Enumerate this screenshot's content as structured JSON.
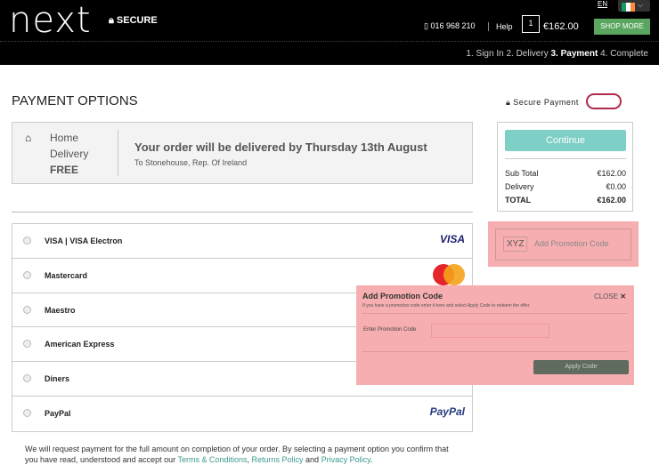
{
  "header": {
    "logo": "next",
    "secure": "SECURE",
    "phone": "016 968 210",
    "help": "Help",
    "bag_count": "1",
    "bag_total": "€162.00",
    "shop_more": "SHOP MORE",
    "language": "EN",
    "steps": [
      "1. Sign In",
      "2. Delivery",
      "3. Payment",
      "4. Complete"
    ],
    "active_step": 2
  },
  "page_title": "PAYMENT OPTIONS",
  "delivery": {
    "line1": "Home",
    "line2": "Delivery",
    "line3": "FREE",
    "message": "Your order will be delivered by Thursday 13th August",
    "address": "To Stonehouse, Rep. Of Ireland"
  },
  "payment_options": [
    {
      "label": "VISA | VISA Electron",
      "logo": "VISA"
    },
    {
      "label": "Mastercard",
      "logo": "MasterCard"
    },
    {
      "label": "Maestro",
      "logo": ""
    },
    {
      "label": "American Express",
      "logo": ""
    },
    {
      "label": "Diners",
      "logo": ""
    },
    {
      "label": "PayPal",
      "logo": "PayPal"
    }
  ],
  "footer": {
    "text": "We will request payment for the full amount on completion of your order. By selecting a payment option you confirm that you have read, understood and accept our ",
    "terms": "Terms & Conditions",
    "comma": ", ",
    "returns": "Returns Policy",
    "and": " and ",
    "privacy": "Privacy Policy",
    "end": "."
  },
  "summary": {
    "secure_payment": "Secure Payment",
    "continue": "Continue",
    "sub_total_label": "Sub Total",
    "sub_total": "€162.00",
    "delivery_label": "Delivery",
    "delivery": "€0.00",
    "total_label": "TOTAL",
    "total": "€162.00"
  },
  "promo": {
    "badge": "XYZ",
    "label": "Add Promotion Code"
  },
  "popup": {
    "title": "Add Promotion Code",
    "close": "CLOSE",
    "subtitle": "If you have a promotion code enter it here and select Apply Code to redeem the offer.",
    "field_label": "Enter Promotion Code",
    "field_value": "",
    "apply": "Apply Code"
  }
}
